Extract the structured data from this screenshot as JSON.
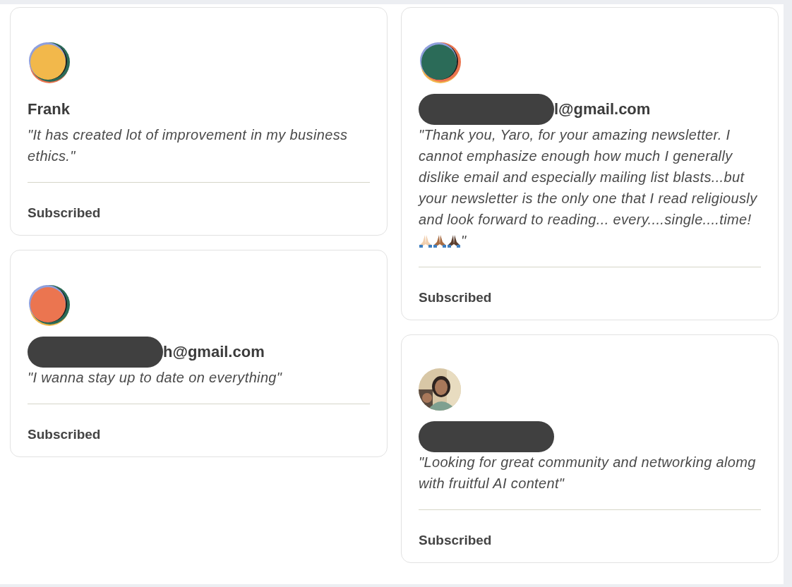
{
  "columns": [
    {
      "cards": [
        {
          "avatar": {
            "kind": "blob",
            "color": "#f2b84b"
          },
          "name": {
            "redacted": false,
            "visible": "Frank"
          },
          "quote": {
            "text": "\"It has created lot of improvement in my business ethics.\""
          },
          "status": "Subscribed"
        },
        {
          "avatar": {
            "kind": "blob",
            "color": "#eb7550"
          },
          "name": {
            "redacted": true,
            "visible": "h@gmail.com"
          },
          "quote": {
            "text": "\"I wanna stay up to date on everything\""
          },
          "status": "Subscribed"
        }
      ]
    },
    {
      "cards": [
        {
          "avatar": {
            "kind": "blob",
            "color": "#2b6b58"
          },
          "name": {
            "redacted": true,
            "visible": "l@gmail.com"
          },
          "quote": {
            "text": "\"Thank you, Yaro, for your amazing newsletter. I cannot emphasize enough how much I generally dislike email and especially mailing list blasts...but your newsletter is the only one that I read religiously and look forward to reading... every....single....time! ",
            "hands": [
              {
                "color": "#f1cfae"
              },
              {
                "color": "#a86c42"
              },
              {
                "color": "#5a3e2e"
              }
            ],
            "closing": "\""
          },
          "status": "Subscribed"
        },
        {
          "name": {
            "redacted": true
          },
          "quote": {
            "text": "\"Looking for great community and networking alomg with fruitful AI content\""
          },
          "status": "Subscribed"
        }
      ]
    }
  ]
}
